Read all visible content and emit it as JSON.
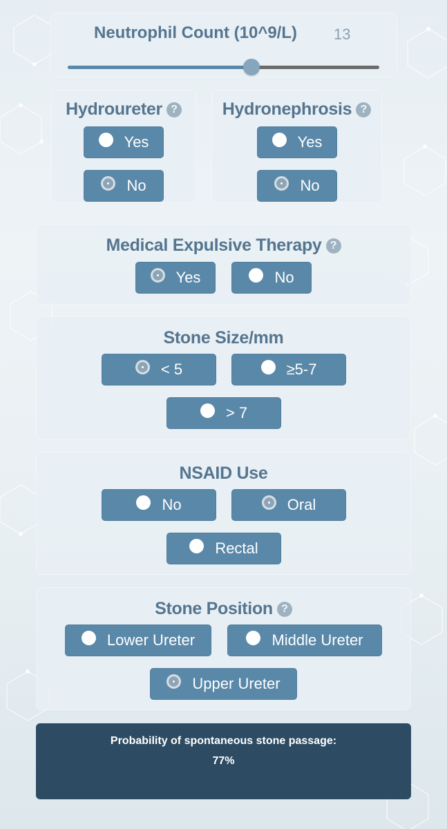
{
  "neutrophil": {
    "label": "Neutrophil Count (10^9/L)",
    "value": "13",
    "slider_fraction": 0.59
  },
  "hydroureter": {
    "label": "Hydroureter",
    "help": "?",
    "options": [
      "Yes",
      "No"
    ],
    "selected": "No"
  },
  "hydronephrosis": {
    "label": "Hydronephrosis",
    "help": "?",
    "options": [
      "Yes",
      "No"
    ],
    "selected": "No"
  },
  "met": {
    "label": "Medical Expulsive Therapy",
    "help": "?",
    "options": [
      "Yes",
      "No"
    ],
    "selected": "Yes"
  },
  "stone_size": {
    "label": "Stone Size/mm",
    "options": [
      "< 5",
      "≥5-7",
      "> 7"
    ],
    "selected": "< 5"
  },
  "nsaid": {
    "label": "NSAID Use",
    "options": [
      "No",
      "Oral",
      "Rectal"
    ],
    "selected": "Oral"
  },
  "stone_position": {
    "label": "Stone Position",
    "help": "?",
    "options": [
      "Lower Ureter",
      "Middle Ureter",
      "Upper Ureter"
    ],
    "selected": "Upper Ureter"
  },
  "result": {
    "label": "Probability of spontaneous stone passage:",
    "value": "77%"
  },
  "colors": {
    "button": "#5a88a8",
    "title": "#55758f",
    "result_bg": "#2d4b63",
    "slider_fill": "#5a88a8",
    "slider_rest": "#6b6b6b"
  }
}
